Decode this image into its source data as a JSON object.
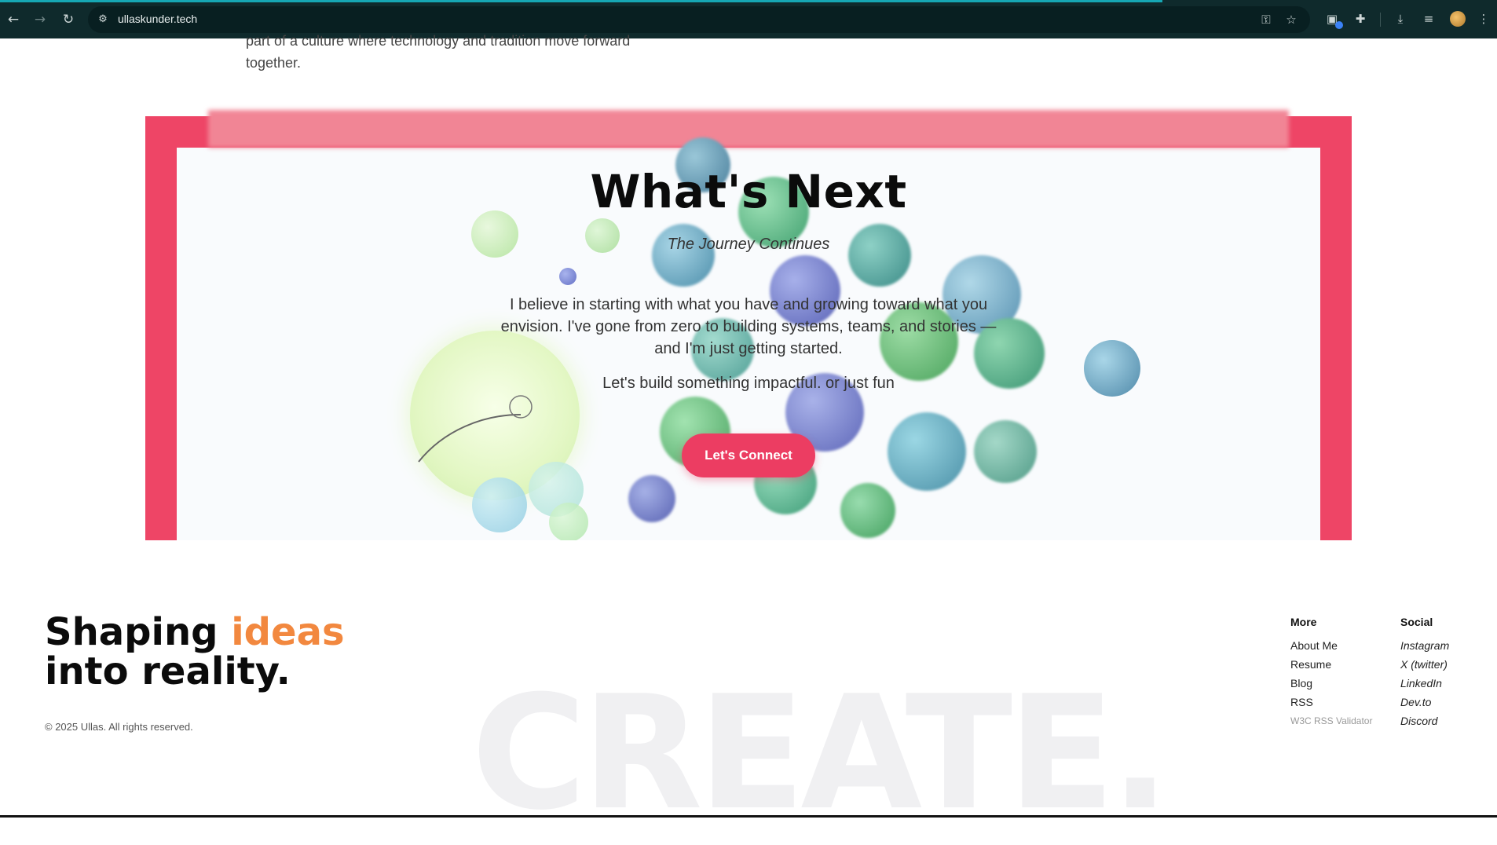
{
  "browser": {
    "url": "ullaskunder.tech",
    "icons": [
      "back-icon",
      "forward-icon",
      "reload-icon",
      "site-settings-icon",
      "password-key-icon",
      "bookmark-star-icon",
      "extension-icon",
      "puzzle-icon",
      "download-icon",
      "reading-list-icon",
      "profile-avatar",
      "menu-icon"
    ]
  },
  "intro": {
    "line1": "part of a culture where technology and tradition move forward",
    "line2": "together."
  },
  "next": {
    "title": "What's Next",
    "subtitle": "The Journey Continues",
    "paragraph": "I believe in starting with what you have and growing toward what you envision. I've gone from zero to building systems, teams, and stories — and I'm just getting started.",
    "cta_line": "Let's build something impactful. or just fun",
    "button": "Let's Connect"
  },
  "footer": {
    "title_word1": "Shaping",
    "title_accent": "ideas",
    "title_line2": "into reality.",
    "copyright": "© 2025 Ullas. All rights reserved.",
    "watermark": "CREATE.",
    "more": {
      "heading": "More",
      "links": [
        "About Me",
        "Resume",
        "Blog",
        "RSS"
      ],
      "small_link": "W3C RSS Validator"
    },
    "social": {
      "heading": "Social",
      "links": [
        "Instagram",
        "X (twitter)",
        "LinkedIn",
        "Dev.to",
        "Discord"
      ]
    }
  },
  "colors": {
    "chrome_bg": "#0f2a2c",
    "frame": "#ee4566",
    "button": "#ec3d62",
    "accent": "#f2883f"
  }
}
